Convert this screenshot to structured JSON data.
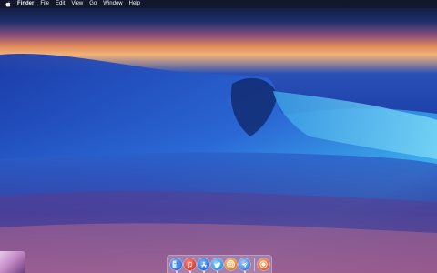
{
  "menubar": {
    "apple_icon": "apple-icon",
    "app_name": "Finder",
    "items": [
      "File",
      "Edit",
      "View",
      "Go",
      "Window",
      "Help"
    ]
  },
  "dock": {
    "items": [
      {
        "name": "finder",
        "icon": "finder-icon",
        "color": "#3b7be6"
      },
      {
        "name": "music",
        "icon": "music-note-icon",
        "color": "#e0453f"
      },
      {
        "name": "app-store",
        "icon": "app-store-icon",
        "color": "#2f7ae5"
      },
      {
        "name": "twitter",
        "icon": "bird-icon",
        "color": "#3aa1ec"
      },
      {
        "name": "target-app",
        "icon": "target-icon",
        "color": "#f08a2a"
      },
      {
        "name": "messages-send",
        "icon": "paper-plane-icon",
        "color": "#4a90e2"
      },
      {
        "name": "trash",
        "icon": "record-icon",
        "color": "#f26a2e"
      }
    ]
  },
  "colors": {
    "menubar_bg": "#141828",
    "sky_orange": "#f2b27a",
    "wave_blue": "#2c6fd6",
    "wave_cyan": "#3fc0ee"
  }
}
